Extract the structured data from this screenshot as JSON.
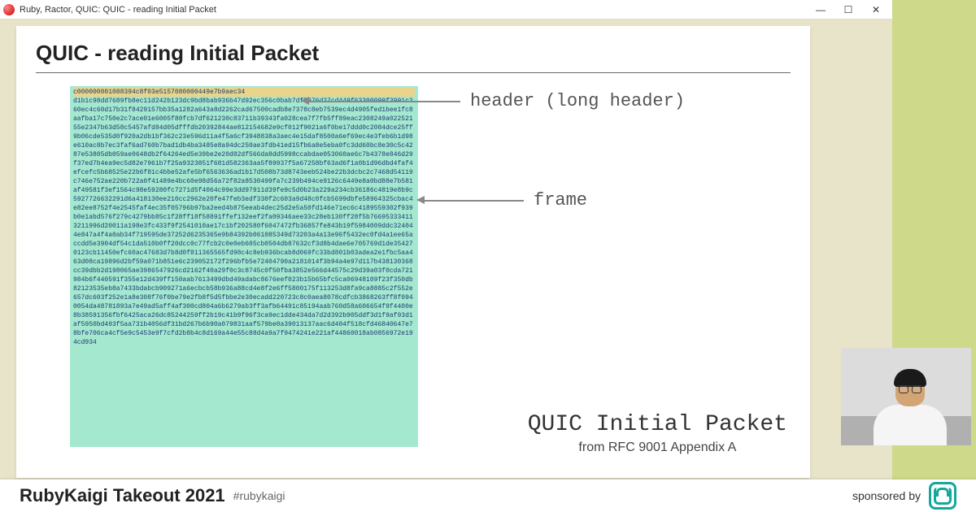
{
  "titlebar": {
    "title": "Ruby, Ractor, QUIC: QUIC - reading Initial Packet"
  },
  "slide": {
    "title": "QUIC - reading Initial Packet",
    "hex_header": "c000000001088394c8f03e5157080000449e7b9aec34",
    "hex_body": "d1b1c98dd7689fb8ec11d242b123dc9bd8bab936b47d92ec356c0bab7df5976d27cd449f63300099f3991c260ec4c60d17b31f8429157bb35a1282a643a8d2262cad67500cadb8e7378c8eb7539ec4d4905fed1bee1fc8aafba17c750e2c7ace01e6005f80fcb7df621230c83711b39343fa028cea7f7fb5ff89eac2308249a02252155e2347b63d58c5457afd84d05dfffdb20392844ae812154682e9cf012f9021a6f0be17ddd0c2084dce25ff9b06cde535d0f920a2db1bf362c23e596d11a4f5a6cf3948838a3aec4e15daf8500a6ef69ec4e3feb6b1d98e610ac8b7ec3faf6ad760b7bad1db4ba3485e8a94dc250ae3fdb41ed15fb6a8e5eba0fc3dd60bc8e30c5c4287e53805db059ae0648db2f64264ed5e39be2e20d82df566da8dd5998ccabdae053060ae6c7b4378e846d29f37ed7b4ea9ec5d82e7961b7f25a9323851f681d582363aa5f89937f5a67258bf63ad6f1a0b1d96dbd4faf4efcefc5b68525e22b6f81c4bbe52afe5bf6563636ad1b17d508b73d8743eeb524be22b3dcbc2c7468d54119c746e752ae220b722a0f41489e4bc60e98d56a72f82a8530499fa7c239b494ce9126c6449e8a0bd88e7b581af49581f3ef1564c98e59280fc7271d5f4064c99e3dd97911d39fe9c5d0b23a229a234cb36186c4819e8b9c5927726632291d6a418130ee210cc2962e20fe47feb3edf330f2c603a9d48c0fcb5699dbfe58964325cbac4e82ee8752f4e2545faf4ec35f05796b97ba2eed4b875eeab4dec25d2e5a50fd146e71ec6c4189559302f939b0e1abd576f279c4279bb85c1f28ff18f58891ffef132eef2fa09346aee33c28eb130ff28f5b766953334113211996d20011a198e3fc433f9f2541010ae17c1bf202580f6047472fb36857fe843b19f5984009ddc324044e847a4f4a0ab34f719595de37252d6235365e9b84392b061085349d73203a4a13e96f5432ec0fd4a1ee65accdd5e3904df54c1da510b0ff20dcc0c77fcb2c0e0eb605cb0504db87632cf3d8b4dae6e705769d1de354270123cb11450efc60ac47683d7b8d0f811365565fd98c4c8eb936bcab8d069fc33bd801b03adea2e1fbc5aa463d08ca19896d2bf59a071b851e6c239052172f296bfb5e72404790a2181014f3b94a4e97d117b438130368cc39dbb2d198065ae3986547926cd2162f40a29f0c3c8745c0f50fba3852e566d44575c29d39a03f0cda721984b6f440591f355e12d439ff150aab7613499dbd49adabc8676eef023b15b65bfc5ca06948109f23f350db82123535eb8a7433bdabcb909271a6ecbcb58b936a88cd4e8f2e6ff5800175f113253d8fa9ca8885c2f552e657dc603f252e1a8e308f76f0be79e2fb8f5d5fbbe2e30ecadd220723c8c0aea8078cdfcb3868263ff8f0940054da48781893a7e49ad5aff4af300cd804a6b6279ab3ff3afb64491c85194aab760d58a606654f9f4400e8b38591356fbf6425aca26dc85244259ff2b19c41b9f96f3ca9ec1dde434da7d2d392b905ddf3d1f9af93d1af5950bd493f5aa731b4056df31bd267b6b90a079831aaf579be0a39013137aac6d404f518cfd46840647e78bfe706ca4cf5e9c5453e9f7cfd2b8b4c8d169a44e55c88d4a9a7f9474241e221af44860018ab0856972e194cd934",
    "annot_header": "header (long header)",
    "annot_frame": "frame",
    "caption_main": "QUIC Initial Packet",
    "caption_sub": "from RFC 9001 Appendix A"
  },
  "footer": {
    "title": "RubyKaigi Takeout 2021",
    "hashtag": "#rubykaigi",
    "sponsored": "sponsored by"
  }
}
